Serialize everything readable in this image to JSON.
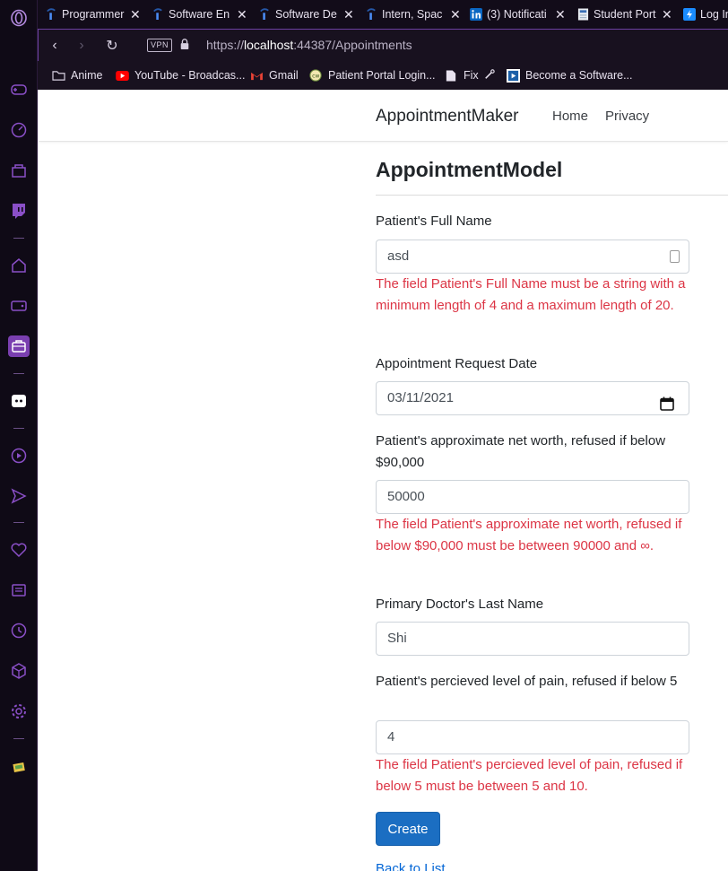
{
  "browser": {
    "tabs": [
      {
        "title": "Programmer",
        "icon": "indeed-icon"
      },
      {
        "title": "Software En",
        "icon": "indeed-icon"
      },
      {
        "title": "Software De",
        "icon": "indeed-icon"
      },
      {
        "title": "Intern, Spac",
        "icon": "indeed-icon"
      },
      {
        "title": "(3) Notificati",
        "icon": "linkedin-icon"
      },
      {
        "title": "Student Port",
        "icon": "document-icon"
      },
      {
        "title": "Log In",
        "icon": "bolt-icon"
      }
    ],
    "vpn_label": "VPN",
    "url_prefix": "https://",
    "url_host": "localhost",
    "url_path": ":44387/Appointments",
    "bookmarks": [
      {
        "label": "Anime",
        "icon": "folder-icon"
      },
      {
        "label": "YouTube - Broadcas...",
        "icon": "youtube-icon"
      },
      {
        "label": "Gmail",
        "icon": "gmail-icon"
      },
      {
        "label": "Patient Portal Login...",
        "icon": "portal-icon"
      },
      {
        "label": "Fix",
        "icon": "page-icon"
      },
      {
        "label": "Become a Software...",
        "icon": "play-square-icon"
      }
    ],
    "colors": {
      "accent": "#7a3fb0",
      "sidebar_bg": "#0f0a16"
    }
  },
  "site": {
    "brand": "AppointmentMaker",
    "nav": [
      "Home",
      "Privacy"
    ]
  },
  "form": {
    "title": "AppointmentModel",
    "full_name": {
      "label": "Patient's Full Name",
      "value": "asd",
      "error": "The field Patient's Full Name must be a string with a minimum length of 4 and a maximum length of 20."
    },
    "request_date": {
      "label": "Appointment Request Date",
      "value": "03/11/2021"
    },
    "net_worth": {
      "label": "Patient's approximate net worth, refused if below $90,000",
      "value": "50000",
      "error": "The field Patient's approximate net worth, refused if below $90,000 must be between 90000 and ∞."
    },
    "doctor": {
      "label": "Primary Doctor's Last Name",
      "value": "Shi"
    },
    "pain": {
      "label": "Patient's percieved level of pain, refused if below 5",
      "value": "4",
      "error": "The field Patient's percieved level of pain, refused if below 5 must be between 5 and 10."
    },
    "submit_label": "Create",
    "back_label": "Back to List"
  },
  "colors": {
    "error": "#dc3545",
    "primary": "#1b6ec2"
  }
}
